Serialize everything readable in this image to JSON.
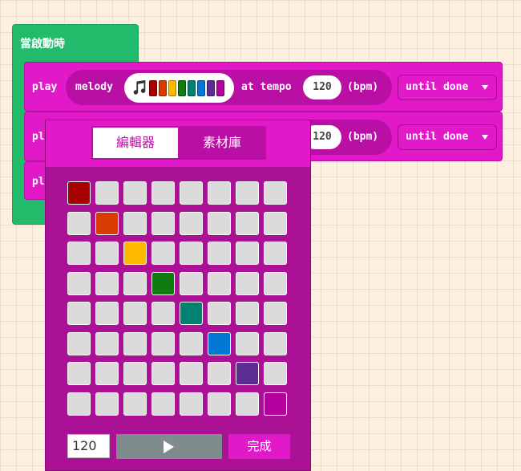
{
  "event_block": {
    "label": "當啟動時",
    "color": "#21bb6b"
  },
  "play_blocks": [
    {
      "play_label": "play",
      "melody_label": "melody",
      "at_tempo_label": "at tempo",
      "tempo_value": "120",
      "bpm_label": "(bpm)",
      "mode": "until done",
      "melody_colors": [
        "#a80000",
        "#d83b01",
        "#ffb900",
        "#107c10",
        "#008272",
        "#0078d4",
        "#5c2d91",
        "#b4009e"
      ]
    },
    {
      "play_label": "play",
      "tempo_value": "120",
      "bpm_label": "(bpm)",
      "mode": "until done"
    },
    {
      "play_label": "play"
    }
  ],
  "editor": {
    "tabs": {
      "editor": "編輯器",
      "gallery": "素材庫"
    },
    "note_colors": [
      "#a80000",
      "#d83b01",
      "#ffb900",
      "#107c10",
      "#008272",
      "#0078d4",
      "#5c2d91",
      "#b4009e"
    ],
    "selected_rows": [
      0,
      1,
      2,
      3,
      4,
      5,
      6,
      7
    ],
    "tempo_value": "120",
    "done_label": "完成",
    "play_icon": "play-triangle-icon"
  },
  "colors": {
    "music_block": "#e219c8",
    "music_block_dark": "#b90fa5",
    "editor_bg": "#aa1195"
  }
}
